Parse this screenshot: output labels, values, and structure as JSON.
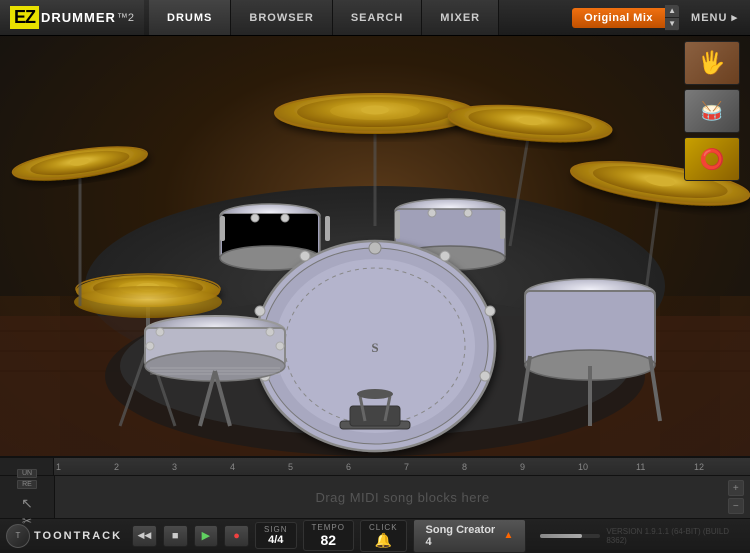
{
  "app": {
    "logo_ez": "EZ",
    "logo_drummer": "DRUMMER",
    "logo_version": "™2"
  },
  "nav": {
    "tabs": [
      {
        "id": "drums",
        "label": "DRUMS",
        "active": true
      },
      {
        "id": "browser",
        "label": "BROWSER",
        "active": false
      },
      {
        "id": "search",
        "label": "SEARCH",
        "active": false
      },
      {
        "id": "mixer",
        "label": "MIXER",
        "active": false
      }
    ]
  },
  "mix": {
    "label": "Original Mix",
    "up_arrow": "▲",
    "down_arrow": "▼"
  },
  "menu": {
    "label": "MENU ▸"
  },
  "timeline": {
    "marks": [
      "1",
      "2",
      "3",
      "4",
      "5",
      "6",
      "7",
      "8",
      "9",
      "10",
      "11",
      "12"
    ]
  },
  "track": {
    "drag_hint": "Drag MIDI song blocks here",
    "undo_label": "UN",
    "redo_label": "RE"
  },
  "transport": {
    "rewind": "◀◀",
    "stop": "■",
    "play": "▶",
    "record": "●"
  },
  "sign": {
    "label": "SIGN",
    "value": "4/4"
  },
  "tempo": {
    "label": "TEMPO",
    "value": "82"
  },
  "click": {
    "label": "CLICK",
    "icon": "🔔"
  },
  "song_creator": {
    "label": "Song Creator 4",
    "arrow": "▲"
  },
  "toontrack": {
    "label": "TOONTRACK"
  },
  "version": {
    "text": "VERSION 1.9.1.1 (64-BIT) (BUILD 8362)"
  },
  "side_panel": {
    "hand": "🖐",
    "stick": "🥢",
    "tambourine": "🪘"
  },
  "colors": {
    "accent_orange": "#f07010",
    "accent_red": "#f04040",
    "bg_dark": "#1a1a1a",
    "bg_mid": "#2a2a2a"
  }
}
